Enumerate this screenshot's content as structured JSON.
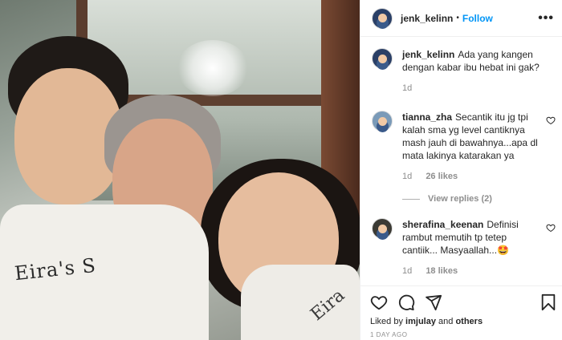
{
  "post": {
    "username": "jenk_kelinn",
    "follow_label": "Follow",
    "more_label": "•••",
    "shirt_text": "Eira's S",
    "shirt_text_2": "Eira"
  },
  "caption": {
    "username": "jenk_kelinn",
    "text": "Ada yang kangen dengan kabar ibu hebat ini gak?",
    "time": "1d"
  },
  "comments": [
    {
      "username": "tianna_zha",
      "text": "Secantik itu jg tpi kalah sma yg level cantiknya mash jauh di bawahnya...apa dl mata lakinya katarakan ya",
      "time": "1d",
      "likes": "26 likes",
      "view_replies": "View replies (2)"
    },
    {
      "username": "sherafina_keenan",
      "text": "Definisi rambut memutih tp tetep cantiik... Masyaallah...🤩",
      "time": "1d",
      "likes": "18 likes"
    }
  ],
  "footer": {
    "liked_by_prefix": "Liked by",
    "liked_by_user": "imjulay",
    "liked_by_and": "and",
    "liked_by_others": "others",
    "time_ago": "1 DAY AGO"
  },
  "colors": {
    "accent": "#0095f6",
    "muted": "#8e8e8e",
    "text": "#262626"
  }
}
